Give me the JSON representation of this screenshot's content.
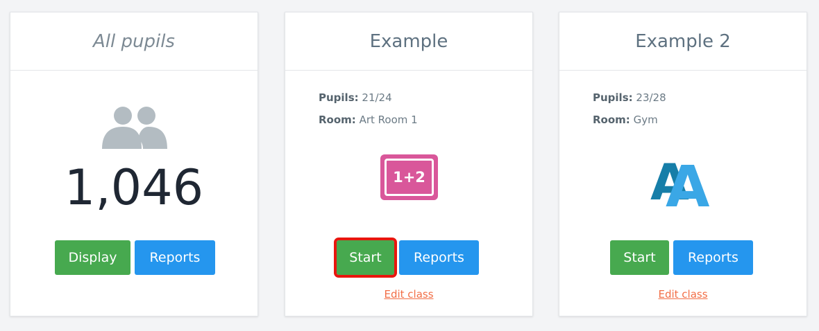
{
  "cards": [
    {
      "title": "All pupils",
      "icon": "pupils-group-icon",
      "count": "1,046",
      "buttons": {
        "primary": "Display",
        "secondary": "Reports"
      }
    },
    {
      "title": "Example",
      "pupils_label": "Pupils:",
      "pupils_value": "21/24",
      "room_label": "Room:",
      "room_value": "Art Room 1",
      "icon": "math-1plus2-icon",
      "icon_text": "1+2",
      "buttons": {
        "primary": "Start",
        "secondary": "Reports"
      },
      "edit_link": "Edit class"
    },
    {
      "title": "Example 2",
      "pupils_label": "Pupils:",
      "pupils_value": "23/28",
      "room_label": "Room:",
      "room_value": "Gym",
      "icon": "letters-aa-icon",
      "icon_text": "AA",
      "buttons": {
        "primary": "Start",
        "secondary": "Reports"
      },
      "edit_link": "Edit class"
    }
  ],
  "colors": {
    "green": "#47a94f",
    "blue": "#2596ee",
    "link": "#f26e46",
    "highlight": "#e8160e",
    "pink": "#d9579a",
    "teal": "#1e8fd1"
  }
}
